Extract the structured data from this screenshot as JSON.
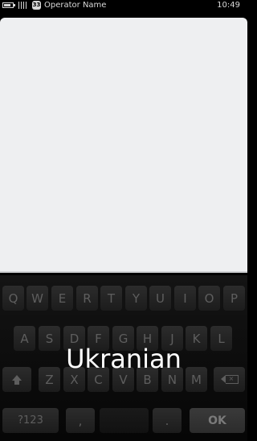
{
  "status_bar": {
    "operator": "Operator Name",
    "time": "10:49",
    "carrier_badge": "33"
  },
  "keyboard": {
    "row1": [
      "Q",
      "W",
      "E",
      "R",
      "T",
      "Y",
      "U",
      "I",
      "O",
      "P"
    ],
    "row2": [
      "A",
      "S",
      "D",
      "F",
      "G",
      "H",
      "J",
      "K",
      "L"
    ],
    "row3": [
      "Z",
      "X",
      "C",
      "V",
      "B",
      "N",
      "M"
    ],
    "row4": {
      "symbols": "?123",
      "comma": ",",
      "period": ".",
      "ok": "OK"
    },
    "language_label": "Ukranian"
  }
}
